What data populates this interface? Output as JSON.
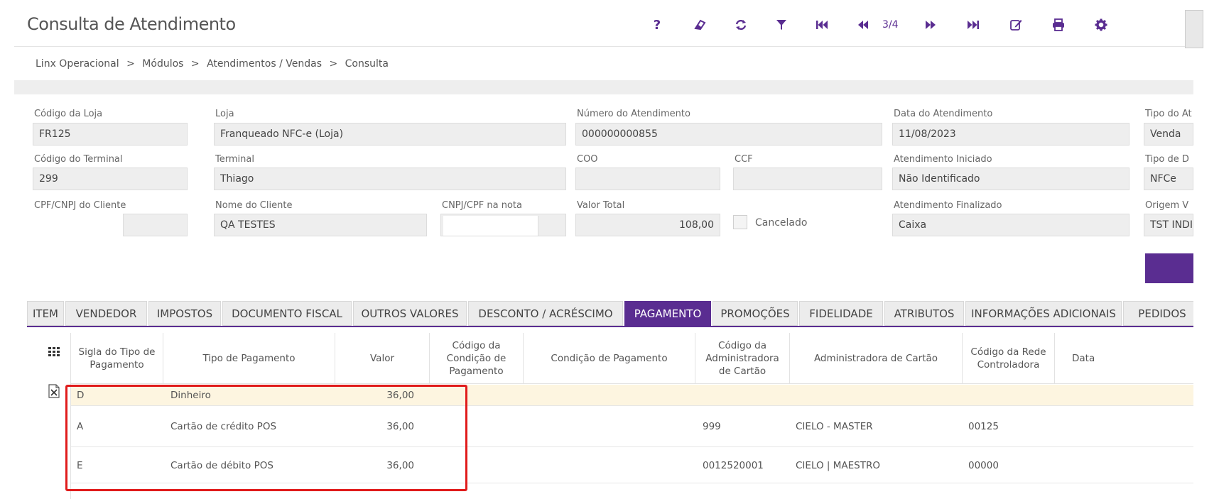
{
  "header": {
    "title": "Consulta de Atendimento",
    "pager": "3/4"
  },
  "icons": [
    "help-icon",
    "eraser-icon",
    "refresh-icon",
    "filter-icon",
    "first-page-icon",
    "previous-page-icon",
    "next-page-icon",
    "last-page-icon",
    "edit-icon",
    "print-icon",
    "gear-icon"
  ],
  "breadcrumb": [
    "Linx Operacional",
    ">",
    "Módulos",
    ">",
    "Atendimentos / Vendas",
    ">",
    "Consulta"
  ],
  "form": {
    "codigo_loja": {
      "label": "Código da Loja",
      "value": "FR125"
    },
    "loja": {
      "label": "Loja",
      "value": "Franqueado NFC-e (Loja)"
    },
    "numero_atendimento": {
      "label": "Número do Atendimento",
      "value": "000000000855"
    },
    "data_atendimento": {
      "label": "Data do Atendimento",
      "value": "11/08/2023"
    },
    "tipo_at": {
      "label": "Tipo do At",
      "value": "Venda"
    },
    "codigo_terminal": {
      "label": "Código do Terminal",
      "value": "299"
    },
    "terminal": {
      "label": "Terminal",
      "value": "Thiago"
    },
    "coo": {
      "label": "COO",
      "value": ""
    },
    "ccf": {
      "label": "CCF",
      "value": ""
    },
    "atendimento_iniciado": {
      "label": "Atendimento Iniciado",
      "value": "Não Identificado"
    },
    "tipo_de_d": {
      "label": "Tipo de D",
      "value": "NFCe"
    },
    "cpf_cliente": {
      "label": "CPF/CNPJ do Cliente",
      "value": ""
    },
    "nome_cliente": {
      "label": "Nome do Cliente",
      "value": "QA TESTES"
    },
    "cnpj_nota": {
      "label": "CNPJ/CPF na nota",
      "value": ""
    },
    "valor_total": {
      "label": "Valor Total",
      "value": "108,00"
    },
    "cancelado": {
      "label": "Cancelado"
    },
    "atendimento_finalizado": {
      "label": "Atendimento Finalizado",
      "value": "Caixa"
    },
    "origem": {
      "label": "Origem V",
      "value": "TST INDI"
    }
  },
  "tabs": [
    "ITEM",
    "VENDEDOR",
    "IMPOSTOS",
    "DOCUMENTO FISCAL",
    "OUTROS VALORES",
    "DESCONTO / ACRÉSCIMO",
    "PAGAMENTO",
    "PROMOÇÕES",
    "FIDELIDADE",
    "ATRIBUTOS",
    "INFORMAÇÕES ADICIONAIS",
    "PEDIDOS"
  ],
  "active_tab": "PAGAMENTO",
  "table": {
    "headers": [
      "Sigla do Tipo de Pagamento",
      "Tipo de Pagamento",
      "Valor",
      "Código da Condição de Pagamento",
      "Condição de Pagamento",
      "Código da Administradora de Cartão",
      "Administradora de Cartão",
      "Código da Rede Controladora",
      "Data"
    ],
    "rows": [
      {
        "sigla": "D",
        "tipo": "Dinheiro",
        "valor": "36,00",
        "cod_cond": "",
        "cond": "",
        "cod_adm": "",
        "adm": "",
        "cod_rede": ""
      },
      {
        "sigla": "A",
        "tipo": "Cartão de crédito POS",
        "valor": "36,00",
        "cod_cond": "",
        "cond": "",
        "cod_adm": "999",
        "adm": "CIELO - MASTER",
        "cod_rede": "00125"
      },
      {
        "sigla": "E",
        "tipo": "Cartão de débito POS",
        "valor": "36,00",
        "cod_cond": "",
        "cond": "",
        "cod_adm": "0012520001",
        "adm": "CIELO | MAESTRO",
        "cod_rede": "00000"
      }
    ]
  },
  "colors": {
    "accent": "#5a2d91",
    "highlight": "#e01b1b",
    "selected_row": "#fdf5e0"
  }
}
